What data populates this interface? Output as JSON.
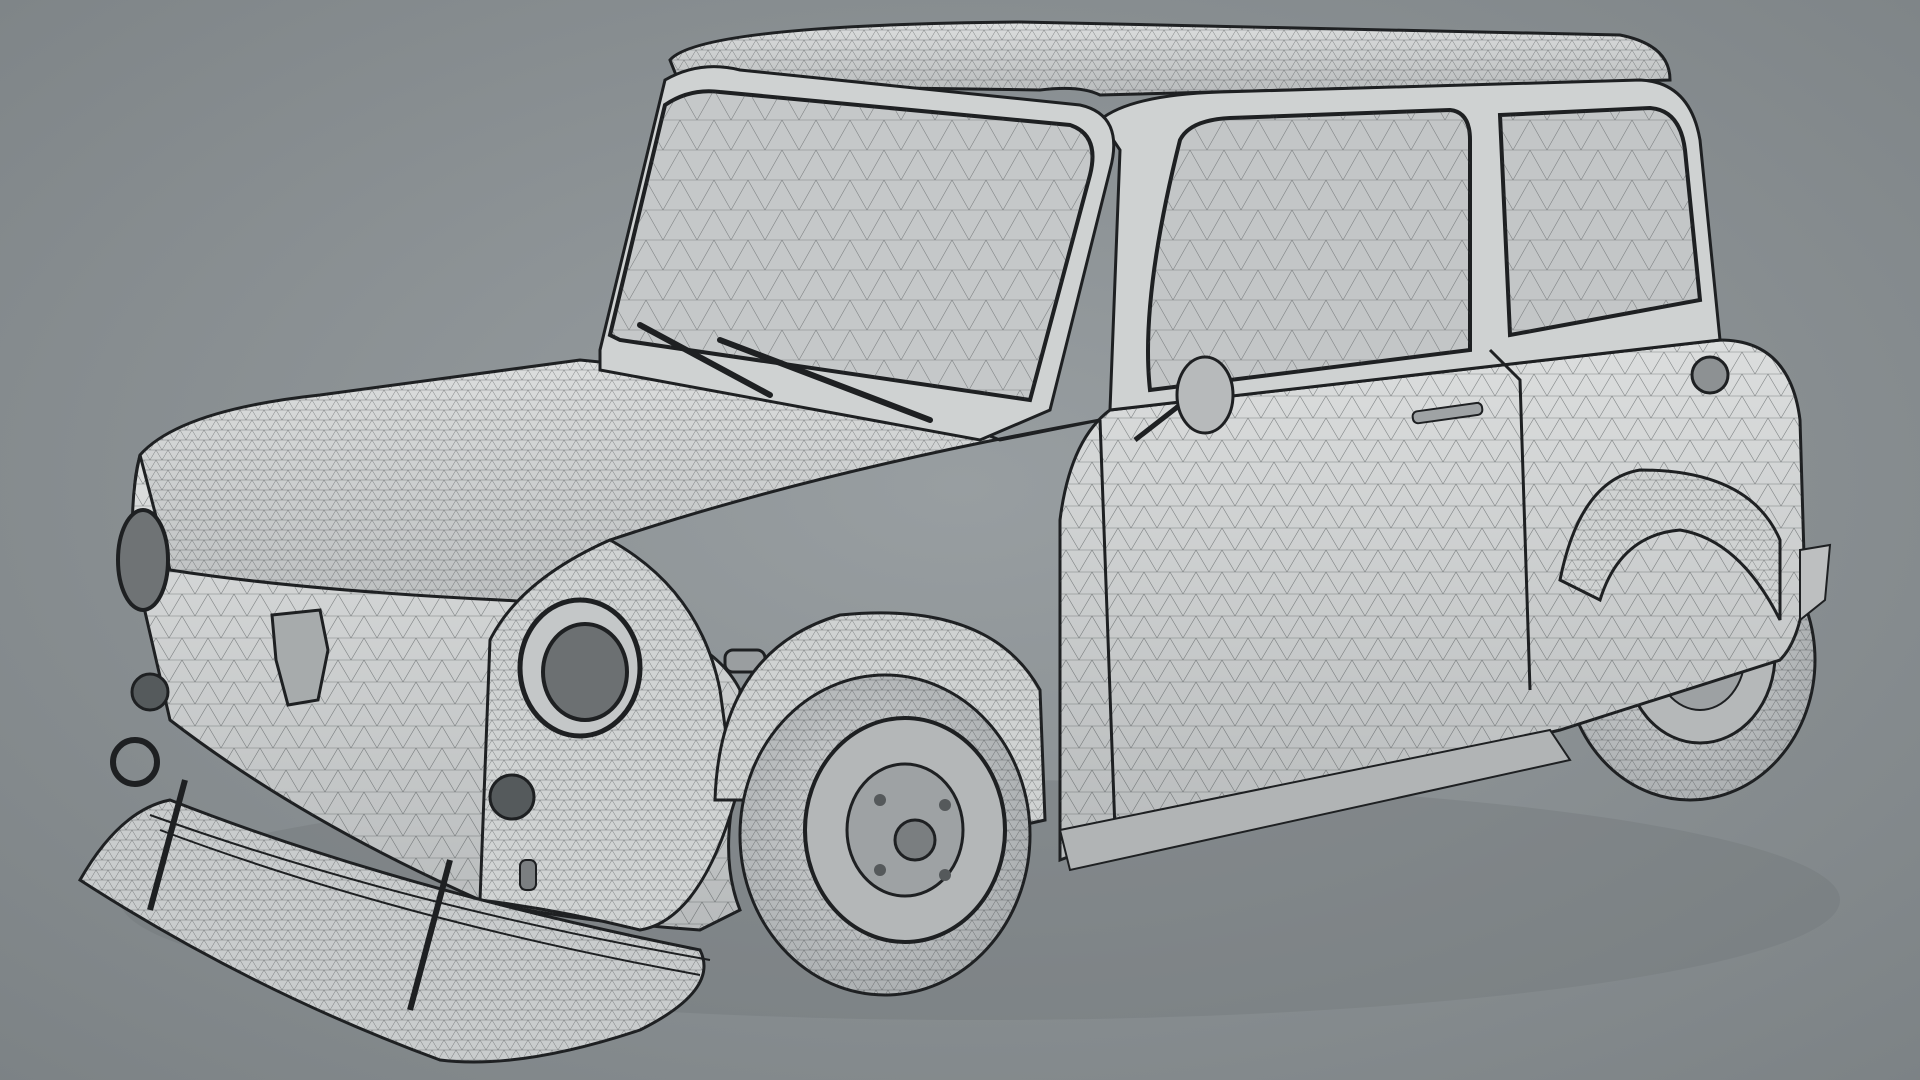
{
  "render": {
    "subject": "car-wireframe-render",
    "colors": {
      "background_light": "#979d9f",
      "background_dark": "#7f8588",
      "body_fill": "#d6d8d8",
      "body_shade": "#b9bcbd",
      "glass_fill": "#c7cacb",
      "wire_line": "#3b3f41",
      "outline": "#1e2022",
      "tire_fill": "#bfc2c3",
      "shadow": "#72787b"
    }
  }
}
